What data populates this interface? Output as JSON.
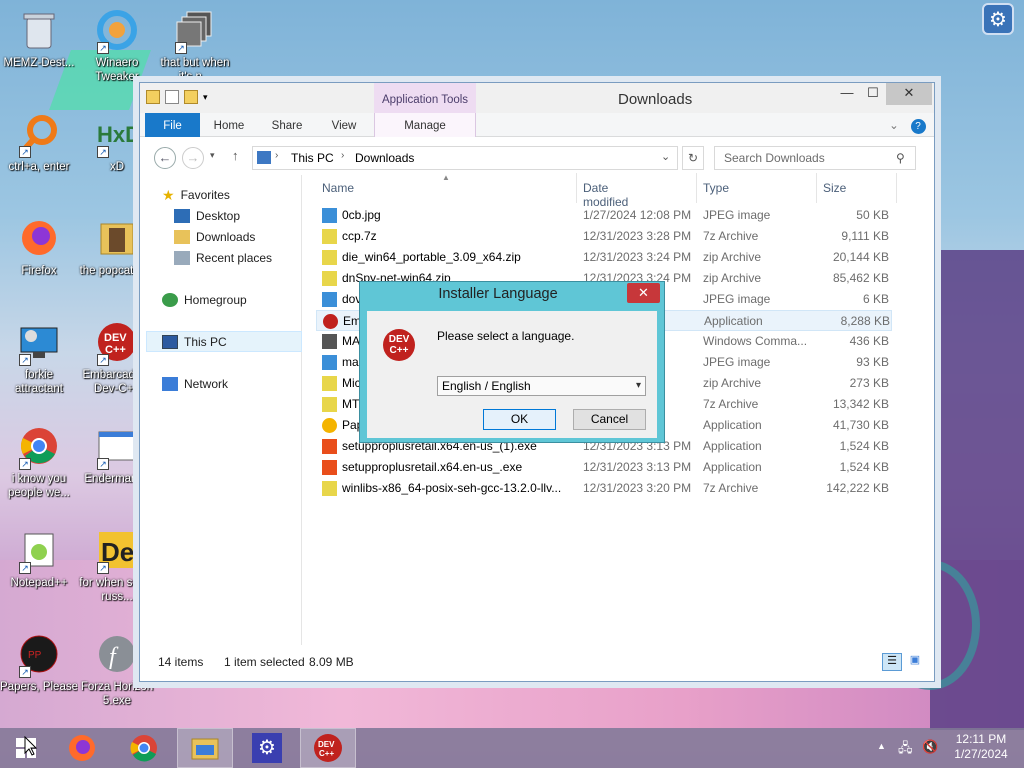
{
  "desktop": {
    "icons": [
      {
        "label": "MEMZ-Dest...",
        "icon": "recycle-bin-icon"
      },
      {
        "label": "Winaero Tweaker",
        "icon": "winaero-icon"
      },
      {
        "label": "that but when it's n...",
        "icon": "stack-icon"
      },
      {
        "label": "ctrl+a, enter",
        "icon": "magnifier-icon"
      },
      {
        "label": "xD",
        "icon": "hxd-icon"
      },
      {
        "label": "Firefox",
        "icon": "firefox-icon"
      },
      {
        "label": "the popcat shit",
        "icon": "folder-icon"
      },
      {
        "label": "forkie attractant",
        "icon": "computer-settings-icon"
      },
      {
        "label": "Embarcadero Dev-C++",
        "icon": "devcpp-icon"
      },
      {
        "label": "i know you people we...",
        "icon": "chrome-icon"
      },
      {
        "label": "Endermanch",
        "icon": "window-icon"
      },
      {
        "label": "Notepad++",
        "icon": "notepadpp-icon"
      },
      {
        "label": "for when some russ...",
        "icon": "de-icon"
      },
      {
        "label": "Papers, Please",
        "icon": "papers-please-icon"
      },
      {
        "label": "Forza Horizon 5.exe",
        "icon": "flash-icon"
      }
    ]
  },
  "explorer": {
    "title": "Downloads",
    "app_tools_label": "Application Tools",
    "tabs": [
      "File",
      "Home",
      "Share",
      "View"
    ],
    "manage_label": "Manage",
    "breadcrumb": [
      "This PC",
      "Downloads"
    ],
    "search_placeholder": "Search Downloads",
    "nav": {
      "favorites": "Favorites",
      "desktop": "Desktop",
      "downloads": "Downloads",
      "recent": "Recent places",
      "homegroup": "Homegroup",
      "thispc": "This PC",
      "network": "Network"
    },
    "columns": [
      "Name",
      "Date modified",
      "Type",
      "Size"
    ],
    "files": [
      {
        "name": "0cb.jpg",
        "date": "1/27/2024 12:08 PM",
        "type": "JPEG image",
        "size": "50 KB",
        "icon": "jpeg"
      },
      {
        "name": "ccp.7z",
        "date": "12/31/2023 3:28 PM",
        "type": "7z Archive",
        "size": "9,111 KB",
        "icon": "archive"
      },
      {
        "name": "die_win64_portable_3.09_x64.zip",
        "date": "12/31/2023 3:24 PM",
        "type": "zip Archive",
        "size": "20,144 KB",
        "icon": "archive"
      },
      {
        "name": "dnSpy-net-win64.zip",
        "date": "12/31/2023 3:24 PM",
        "type": "zip Archive",
        "size": "85,462 KB",
        "icon": "archive"
      },
      {
        "name": "dov",
        "date": "PM",
        "type": "JPEG image",
        "size": "6 KB",
        "icon": "jpeg"
      },
      {
        "name": "Em",
        "date": "PM",
        "type": "Application",
        "size": "8,288 KB",
        "icon": "devcpp",
        "selected": true
      },
      {
        "name": "MA",
        "date": "AM",
        "type": "Windows Comma...",
        "size": "436 KB",
        "icon": "cmd"
      },
      {
        "name": "ma",
        "date": "PM",
        "type": "JPEG image",
        "size": "93 KB",
        "icon": "jpeg"
      },
      {
        "name": "Mic",
        "date": "PM",
        "type": "zip Archive",
        "size": "273 KB",
        "icon": "archive"
      },
      {
        "name": "MT",
        "date": "PM",
        "type": "7z Archive",
        "size": "13,342 KB",
        "icon": "archive"
      },
      {
        "name": "Pap",
        "date": "PM",
        "type": "Application",
        "size": "41,730 KB",
        "icon": "app-yellow"
      },
      {
        "name": "setupproplusretail.x64.en-us_(1).exe",
        "date": "12/31/2023 3:13 PM",
        "type": "Application",
        "size": "1,524 KB",
        "icon": "office"
      },
      {
        "name": "setupproplusretail.x64.en-us_.exe",
        "date": "12/31/2023 3:13 PM",
        "type": "Application",
        "size": "1,524 KB",
        "icon": "office"
      },
      {
        "name": "winlibs-x86_64-posix-seh-gcc-13.2.0-llv...",
        "date": "12/31/2023 3:20 PM",
        "type": "7z Archive",
        "size": "142,222 KB",
        "icon": "archive"
      }
    ],
    "status": {
      "items": "14 items",
      "selected": "1 item selected",
      "size": "8.09 MB"
    }
  },
  "dialog": {
    "title": "Installer Language",
    "message": "Please select a language.",
    "selected_language": "English / English",
    "ok": "OK",
    "cancel": "Cancel",
    "icon_text": "DEV C++"
  },
  "taskbar": {
    "time": "12:11 PM",
    "date": "1/27/2024",
    "apps": [
      "start-button",
      "firefox",
      "chrome",
      "file-explorer",
      "settings",
      "dev-cpp-installer"
    ]
  }
}
